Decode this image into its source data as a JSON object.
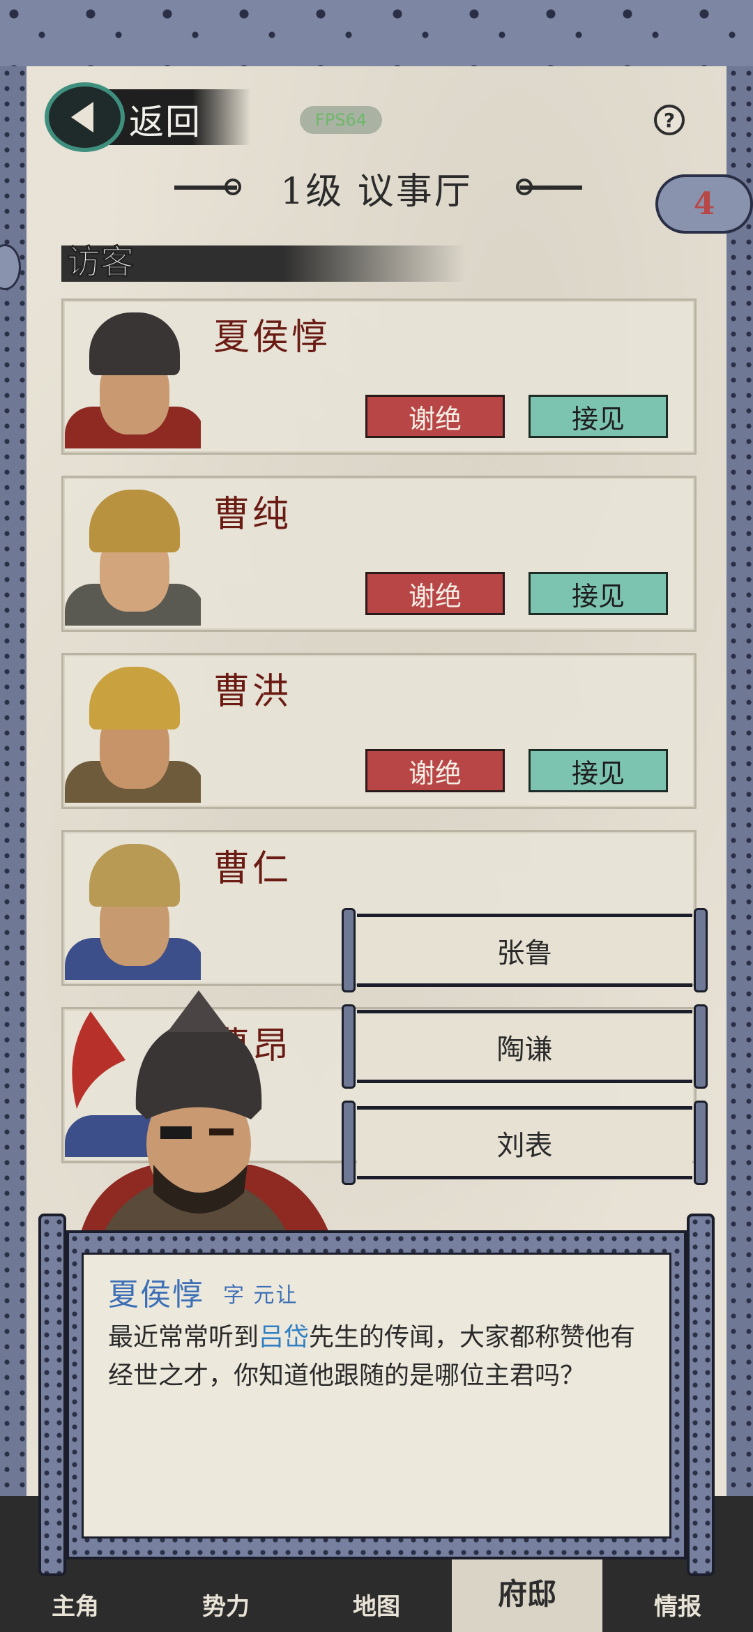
{
  "header": {
    "back_label": "返回",
    "fps": "FPS64",
    "help_icon": "?",
    "title": "1级 议事厅",
    "badge_count": "4"
  },
  "section": {
    "label": "访客"
  },
  "visitors": [
    {
      "name": "夏侯惇",
      "decline": "谢绝",
      "accept": "接见"
    },
    {
      "name": "曹纯",
      "decline": "谢绝",
      "accept": "接见"
    },
    {
      "name": "曹洪",
      "decline": "谢绝",
      "accept": "接见"
    },
    {
      "name": "曹仁"
    },
    {
      "name": "曹昂"
    }
  ],
  "options": [
    "张鲁",
    "陶谦",
    "刘表"
  ],
  "dialog": {
    "speaker": "夏侯惇",
    "courtesy": "字 元让",
    "text_part1": "最近常常听到",
    "highlight": "吕岱",
    "text_part2": "先生的传闻，大家都称赞他有经世之才，你知道他跟随的是哪位主君吗？"
  },
  "nav": {
    "tabs": [
      "主角",
      "势力",
      "地图",
      "府邸",
      "情报"
    ],
    "active": "府邸"
  },
  "colors": {
    "decline": "#b94646",
    "accept": "#7cc3b0",
    "name_red": "#6a1c14",
    "dialog_blue": "#3d6fb6"
  }
}
